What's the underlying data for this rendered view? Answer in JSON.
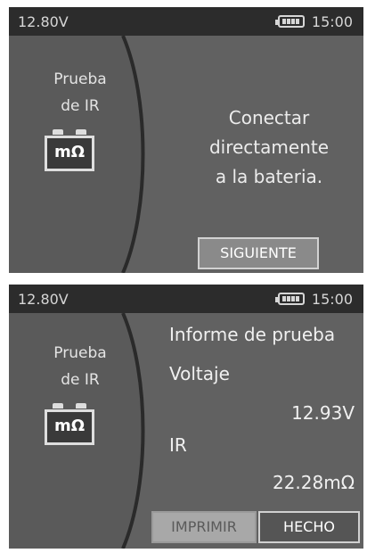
{
  "screen_one": {
    "status": {
      "voltage": "12.80V",
      "time": "15:00"
    },
    "side": {
      "title_line1": "Prueba",
      "title_line2": "de IR",
      "icon_text": "mΩ"
    },
    "message": {
      "line1": "Conectar",
      "line2": "directamente",
      "line3": "a la bateria."
    },
    "next_button": "SIGUIENTE"
  },
  "screen_two": {
    "status": {
      "voltage": "12.80V",
      "time": "15:00"
    },
    "side": {
      "title_line1": "Prueba",
      "title_line2": "de IR",
      "icon_text": "mΩ"
    },
    "report": {
      "title": "Informe de prueba",
      "voltage_label": "Voltaje",
      "voltage_value": "12.93V",
      "ir_label": "IR",
      "ir_value": "22.28mΩ"
    },
    "print_button": "IMPRIMIR",
    "done_button": "HECHO"
  }
}
